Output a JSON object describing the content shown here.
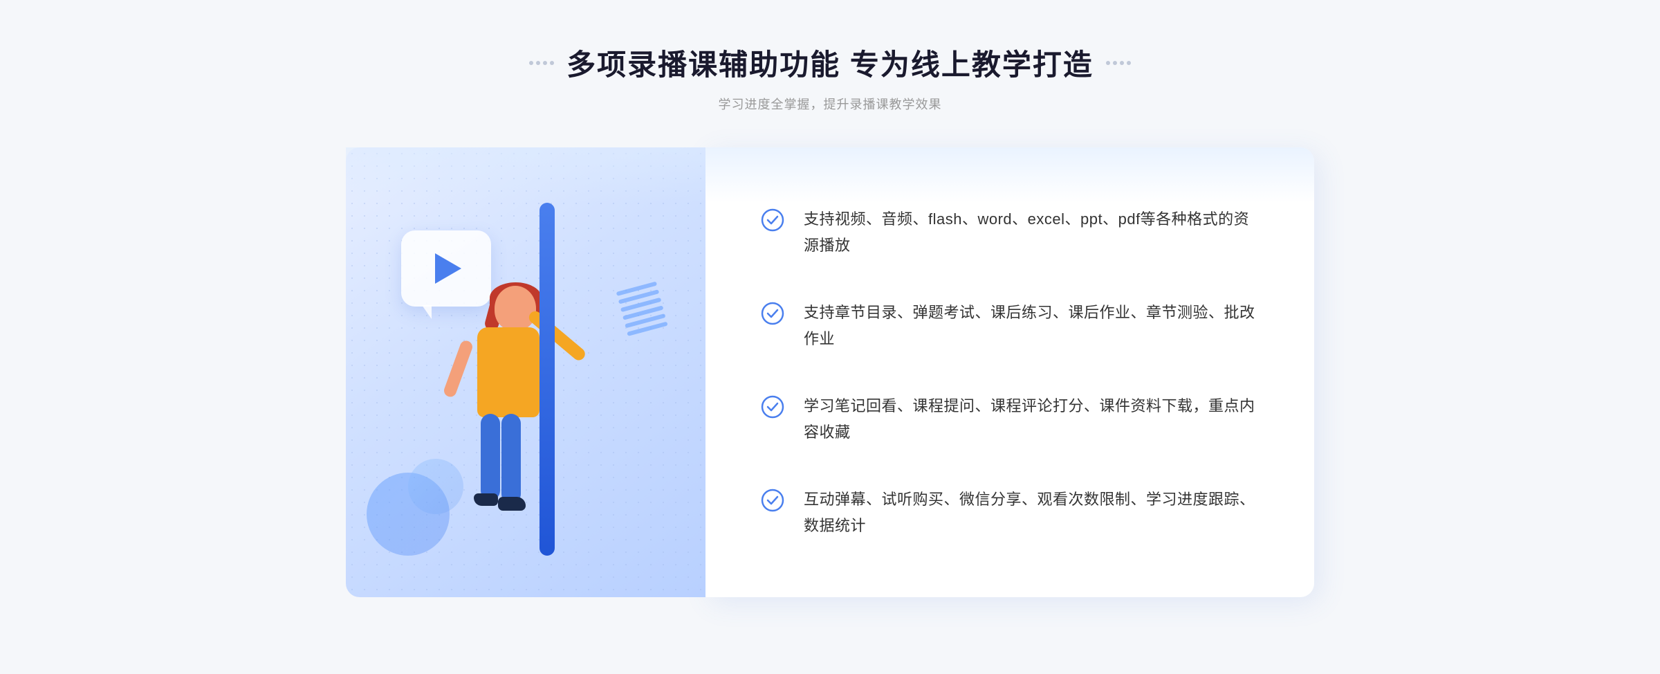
{
  "header": {
    "title": "多项录播课辅助功能 专为线上教学打造",
    "subtitle": "学习进度全掌握，提升录播课教学效果"
  },
  "features": [
    {
      "id": "feature-1",
      "text": "支持视频、音频、flash、word、excel、ppt、pdf等各种格式的资源播放"
    },
    {
      "id": "feature-2",
      "text": "支持章节目录、弹题考试、课后练习、课后作业、章节测验、批改作业"
    },
    {
      "id": "feature-3",
      "text": "学习笔记回看、课程提问、课程评论打分、课件资料下载，重点内容收藏"
    },
    {
      "id": "feature-4",
      "text": "互动弹幕、试听购买、微信分享、观看次数限制、学习进度跟踪、数据统计"
    }
  ],
  "decorative": {
    "left_chevrons": "»",
    "title_dots_left": "⁚",
    "title_dots_right": "⁚"
  }
}
